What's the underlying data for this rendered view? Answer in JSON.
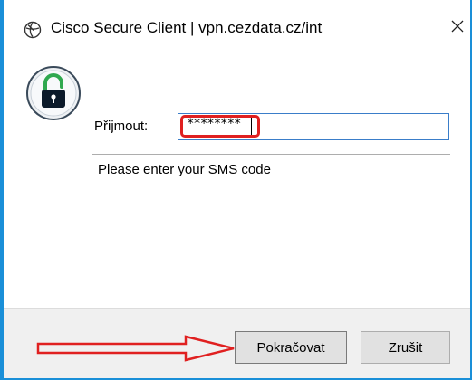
{
  "window": {
    "title": "Cisco Secure Client | vpn.cezdata.cz/int",
    "title_icon": "cisco-secure-client-icon",
    "close_icon": "close-icon",
    "accent_color": "#1a8fd8"
  },
  "form": {
    "lock_icon": "lock-icon",
    "label": "Přijmout:",
    "password_value": "********",
    "message": "Please enter your SMS code"
  },
  "buttons": {
    "continue_label": "Pokračovat",
    "cancel_label": "Zrušit"
  },
  "annotations": {
    "highlight_color": "#e02020"
  }
}
